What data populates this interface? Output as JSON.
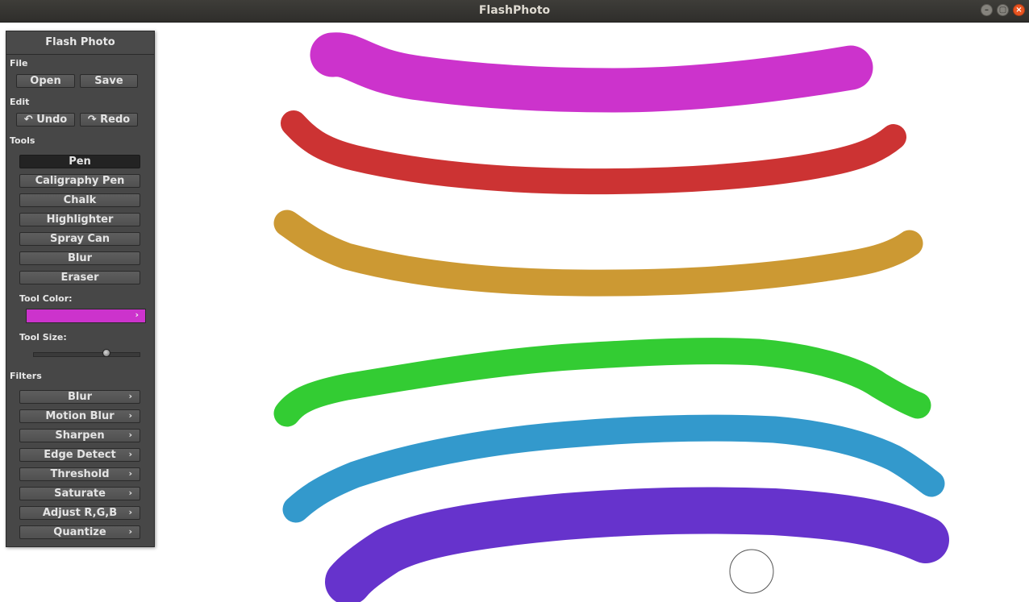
{
  "window": {
    "title": "FlashPhoto",
    "minimize_glyph": "–",
    "maximize_glyph": "▢",
    "close_glyph": "×"
  },
  "panel": {
    "title": "Flash Photo",
    "file": {
      "label": "File",
      "open": "Open",
      "save": "Save"
    },
    "edit": {
      "label": "Edit",
      "undo": "Undo",
      "redo": "Redo",
      "undo_icon": "↶",
      "redo_icon": "↷"
    },
    "tools": {
      "label": "Tools",
      "items": [
        "Pen",
        "Caligraphy Pen",
        "Chalk",
        "Highlighter",
        "Spray Can",
        "Blur",
        "Eraser"
      ],
      "selected": "Pen",
      "tool_color_label": "Tool Color:",
      "tool_color": "#cc33cc",
      "tool_size_label": "Tool Size:",
      "tool_size_fraction": 0.7
    },
    "filters": {
      "label": "Filters",
      "items": [
        "Blur",
        "Motion Blur",
        "Sharpen",
        "Edge Detect",
        "Threshold",
        "Saturate",
        "Adjust R,G,B",
        "Quantize"
      ]
    },
    "expand_glyph": "›"
  },
  "canvas": {
    "strokes": [
      {
        "color": "#cc33cc"
      },
      {
        "color": "#cc3333"
      },
      {
        "color": "#cc9933"
      },
      {
        "color": "#33cc33"
      },
      {
        "color": "#3399cc"
      },
      {
        "color": "#6633cc"
      }
    ]
  }
}
